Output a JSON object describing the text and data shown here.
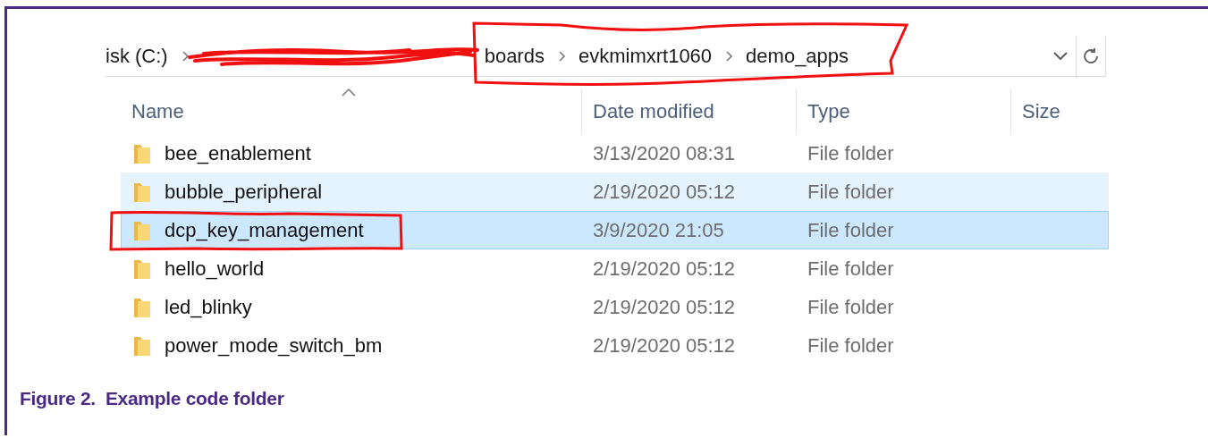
{
  "address_bar": {
    "segments": [
      {
        "kind": "text",
        "label": "isk (C:)"
      },
      {
        "kind": "redacted"
      }
    ],
    "circled_segments": [
      {
        "kind": "text",
        "label": "boards"
      },
      {
        "kind": "text",
        "label": "evkmimxrt1060"
      },
      {
        "kind": "text",
        "label": "demo_apps"
      }
    ]
  },
  "columns": [
    {
      "label": "Name",
      "sorted": true
    },
    {
      "label": "Date modified",
      "sorted": false
    },
    {
      "label": "Type",
      "sorted": false
    },
    {
      "label": "Size",
      "sorted": false
    }
  ],
  "rows": [
    {
      "name": "bee_enablement",
      "date": "3/13/2020 08:31",
      "type": "File folder",
      "selected": false,
      "hovered": false,
      "annotated": false
    },
    {
      "name": "bubble_peripheral",
      "date": "2/19/2020 05:12",
      "type": "File folder",
      "selected": false,
      "hovered": true,
      "annotated": false
    },
    {
      "name": "dcp_key_management",
      "date": "3/9/2020 21:05",
      "type": "File folder",
      "selected": true,
      "hovered": false,
      "annotated": true
    },
    {
      "name": "hello_world",
      "date": "2/19/2020 05:12",
      "type": "File folder",
      "selected": false,
      "hovered": false,
      "annotated": false
    },
    {
      "name": "led_blinky",
      "date": "2/19/2020 05:12",
      "type": "File folder",
      "selected": false,
      "hovered": false,
      "annotated": false
    },
    {
      "name": "power_mode_switch_bm",
      "date": "2/19/2020 05:12",
      "type": "File folder",
      "selected": false,
      "hovered": false,
      "annotated": false
    }
  ],
  "caption": "Figure 2.  Example code folder"
}
